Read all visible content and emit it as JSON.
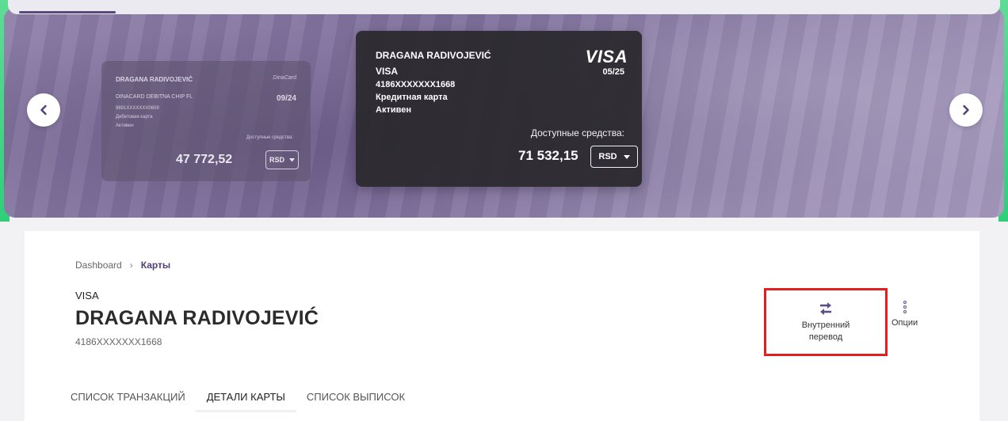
{
  "carousel": {
    "cards": [
      {
        "holder": "DRAGANA RADIVOJEVIĆ",
        "product": "DINACARD DEBITNA CHIP FL",
        "number": "9891XXXXXXX0609",
        "type": "Дебетовая карта",
        "status": "Активен",
        "brand": "DinaCard",
        "expiry": "09/24",
        "available_label": "Доступные средства:",
        "amount": "47 772,52",
        "currency": "RSD"
      },
      {
        "holder": "DRAGANA RADIVOJEVIĆ",
        "product": "VISA",
        "number": "4186XXXXXXX1668",
        "type": "Кредитная карта",
        "status": "Активен",
        "brand": "VISA",
        "expiry": "05/25",
        "available_label": "Доступные средства:",
        "amount": "71 532,15",
        "currency": "RSD"
      }
    ]
  },
  "breadcrumb": {
    "home": "Dashboard",
    "current": "Карты"
  },
  "card_details": {
    "label": "VISA",
    "holder": "DRAGANA RADIVOJEVIĆ",
    "number": "4186XXXXXXX1668"
  },
  "actions": {
    "transfer_line1": "Внутренний",
    "transfer_line2": "перевод",
    "options": "Опции"
  },
  "tabs": [
    {
      "label": "СПИСОК ТРАНЗАКЦИЙ"
    },
    {
      "label": "ДЕТАЛИ КАРТЫ"
    },
    {
      "label": "СПИСОК ВЫПИСОК"
    }
  ],
  "colors": {
    "accent": "#5a4a7c",
    "highlight_border": "#e02020",
    "green_edge": "#2fcf7a"
  }
}
